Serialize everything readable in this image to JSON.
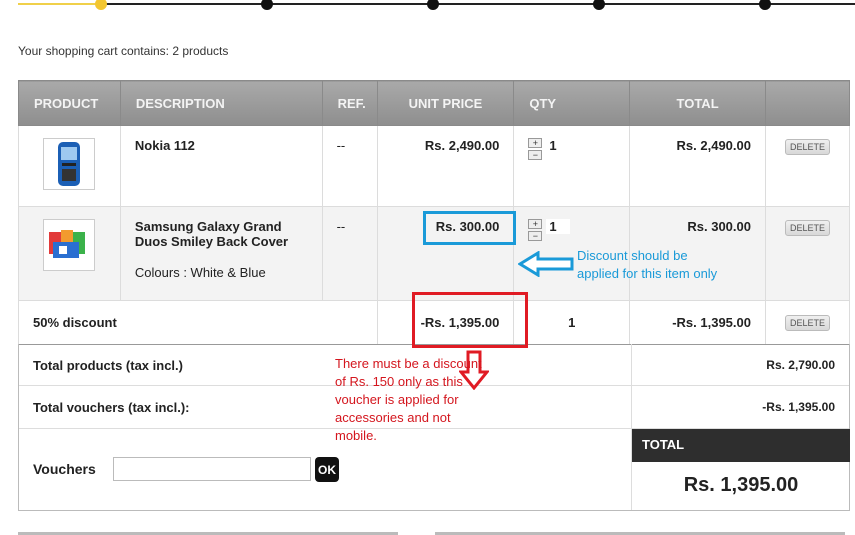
{
  "cart_summary": "Your shopping cart contains: 2 products",
  "columns": {
    "product": "PRODUCT",
    "description": "DESCRIPTION",
    "ref": "REF.",
    "unit_price": "UNIT PRICE",
    "qty": "QTY",
    "total": "TOTAL"
  },
  "items": [
    {
      "name": "Nokia 112",
      "subtitle": "",
      "ref": "--",
      "unit_price": "Rs. 2,490.00",
      "qty": "1",
      "total": "Rs. 2,490.00",
      "delete_label": "DELETE"
    },
    {
      "name": "Samsung Galaxy Grand Duos Smiley Back Cover",
      "subtitle": "Colours : White & Blue",
      "ref": "--",
      "unit_price": "Rs. 300.00",
      "qty": "1",
      "total": "Rs. 300.00",
      "delete_label": "DELETE"
    }
  ],
  "discount": {
    "label": "50% discount",
    "unit_price": "-Rs. 1,395.00",
    "qty": "1",
    "total": "-Rs. 1,395.00",
    "delete_label": "DELETE"
  },
  "totals": {
    "products_label": "Total products (tax incl.)",
    "products_value": "Rs. 2,790.00",
    "vouchers_label": "Total vouchers (tax incl.):",
    "vouchers_value": "-Rs. 1,395.00",
    "total_label": "TOTAL",
    "total_value": "Rs. 1,395.00"
  },
  "voucher": {
    "label": "Vouchers",
    "input_value": "",
    "ok_label": "OK"
  },
  "annotations": {
    "blue_note_line1": "Discount should be",
    "blue_note_line2": "applied for this item only",
    "red_note": "There must be a discount of Rs. 150 only as this voucher is applied for accessories and not mobile."
  },
  "colors": {
    "step_active": "#f3c630",
    "annotation_blue": "#1a9ad8",
    "annotation_red": "#e01b24",
    "header_gray": "#999999",
    "total_box": "#2e2e2e"
  }
}
